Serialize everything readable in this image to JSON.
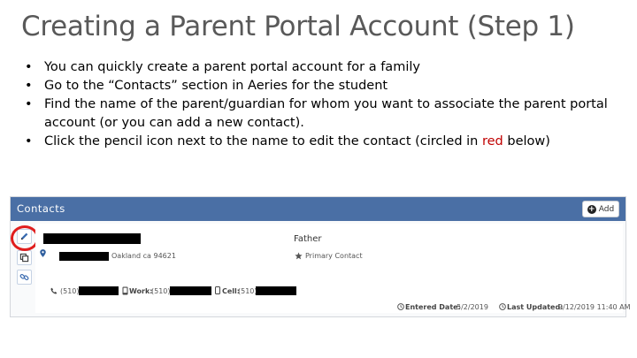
{
  "slide": {
    "title": "Creating a Parent Portal Account (Step 1)",
    "bullet_glyph": "•",
    "bullets": {
      "b1": "You can quickly create a parent portal account for a family",
      "b2": "Go to the “Contacts” section in Aeries for the student",
      "b3": "Find the name of the parent/guardian for whom you want to associate the parent portal account (or you can add a new contact).",
      "b4_before": "Click the pencil icon next to the name to edit the contact (circled in ",
      "b4_red": "red",
      "b4_after": " below)"
    }
  },
  "panel": {
    "title": "Contacts",
    "add_label": "Add",
    "contact": {
      "address_city": "Oakland ca 94621",
      "relationship": "Father",
      "primary_label": "Primary Contact",
      "phone_prefix": "(510)",
      "work_label": "Work:",
      "work_prefix": "(510)",
      "cell_label": "Cell:",
      "cell_prefix": "(510)",
      "entered_label": "Entered Date:",
      "entered_value": "5/2/2019",
      "updated_label": "Last Updated:",
      "updated_value": "9/12/2019 11:40 AM"
    }
  },
  "colors": {
    "header_blue": "#4a6fa5",
    "highlight_red": "#e01e1e",
    "text_red": "#c00000",
    "title_gray": "#595959"
  },
  "icons": [
    "pencil-icon",
    "copy-icon",
    "link-icon",
    "map-pin-icon",
    "star-icon",
    "phone-icon",
    "mobile-icon",
    "clock-icon",
    "plus-circle-icon"
  ]
}
